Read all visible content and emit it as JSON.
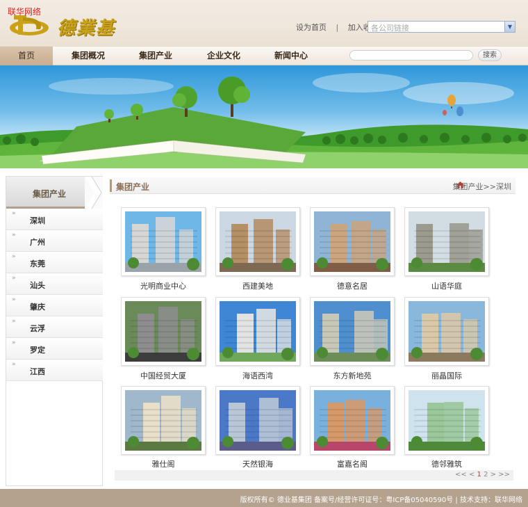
{
  "watermark": "联华网络",
  "logo": {
    "name": "德業基"
  },
  "top_links": {
    "set_home": "设为首页",
    "separator": "|",
    "add_favorite": "加入收藏"
  },
  "company_select": {
    "selected": "各公司链接"
  },
  "nav": {
    "home": "首页",
    "items": [
      "集团概况",
      "集团产业",
      "企业文化",
      "新闻中心"
    ]
  },
  "search": {
    "button": "搜索"
  },
  "sidebar": {
    "title": "集团产业",
    "items": [
      "深圳",
      "广州",
      "东莞",
      "汕头",
      "肇庆",
      "云浮",
      "罗定",
      "江西"
    ]
  },
  "content": {
    "title": "集团产业",
    "breadcrumb": "集团产业>>深圳"
  },
  "projects": [
    {
      "name": "光明商业中心"
    },
    {
      "name": "西建美地"
    },
    {
      "name": "德意名居"
    },
    {
      "name": "山语华庭"
    },
    {
      "name": "中国经贸大厦"
    },
    {
      "name": "海语西湾"
    },
    {
      "name": "东方新地苑"
    },
    {
      "name": "丽晶国际"
    },
    {
      "name": "雅仕阁"
    },
    {
      "name": "天然银海"
    },
    {
      "name": "富嘉名阁"
    },
    {
      "name": "德邻雅筑"
    }
  ],
  "pager": {
    "prev": "<< <",
    "current": "1",
    "next_page": "2",
    "next": "> >>"
  },
  "footer": {
    "text": "版权所有© 德业基集团  备案号/经营许可证号：粤ICP备05040590号  |  技术支持：联华网络"
  }
}
